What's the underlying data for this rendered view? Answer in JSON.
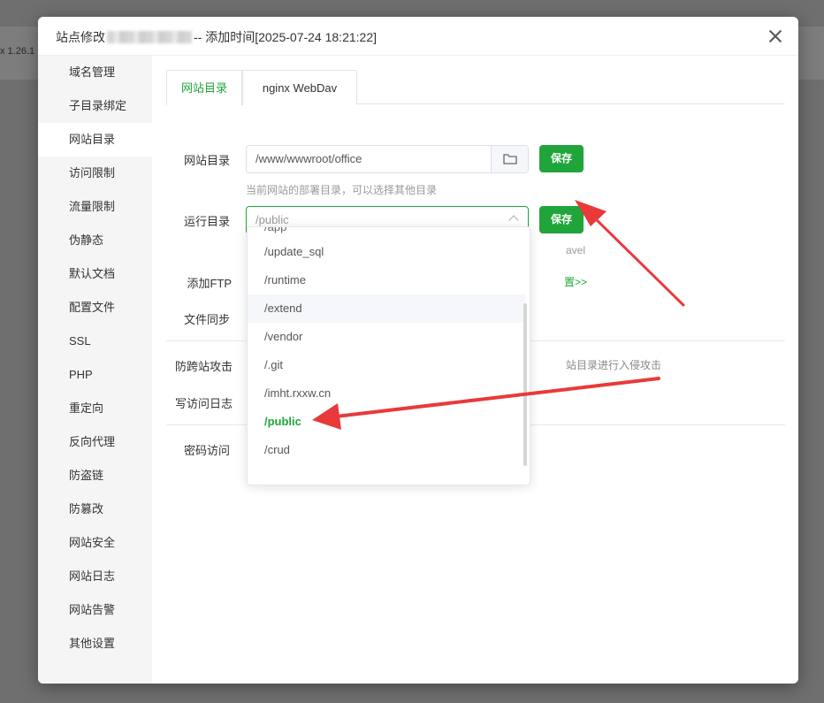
{
  "background": {
    "version_text": "x 1.26.1"
  },
  "modal": {
    "title_prefix": "站点修改",
    "title_suffix": "-- 添加时间[2025-07-24 18:21:22]"
  },
  "sidebar": {
    "items": [
      {
        "label": "域名管理"
      },
      {
        "label": "子目录绑定"
      },
      {
        "label": "网站目录"
      },
      {
        "label": "访问限制"
      },
      {
        "label": "流量限制"
      },
      {
        "label": "伪静态"
      },
      {
        "label": "默认文档"
      },
      {
        "label": "配置文件"
      },
      {
        "label": "SSL"
      },
      {
        "label": "PHP"
      },
      {
        "label": "重定向"
      },
      {
        "label": "反向代理"
      },
      {
        "label": "防盗链"
      },
      {
        "label": "防篡改"
      },
      {
        "label": "网站安全"
      },
      {
        "label": "网站日志"
      },
      {
        "label": "网站告警"
      },
      {
        "label": "其他设置"
      }
    ],
    "active_index": 2
  },
  "tabs": [
    {
      "label": "网站目录"
    },
    {
      "label": "nginx WebDav"
    }
  ],
  "form": {
    "site_dir_label": "网站目录",
    "site_dir_value": "/www/wwwroot/office",
    "save_label": "保存",
    "site_dir_hint": "当前网站的部署目录，可以选择其他目录",
    "run_dir_label": "运行目录",
    "run_dir_placeholder": "/public",
    "run_dir_hint_tail": "avel",
    "ftp_label": "添加FTP",
    "ftp_link_tail": "置>>",
    "sync_label": "文件同步",
    "anti_cross_label": "防跨站攻击",
    "anti_cross_hint_tail": "站目录进行入侵攻击",
    "access_log_label": "写访问日志",
    "password_label": "密码访问"
  },
  "dropdown": {
    "partial_top": "/app",
    "options": [
      {
        "label": "/update_sql"
      },
      {
        "label": "/runtime"
      },
      {
        "label": "/extend"
      },
      {
        "label": "/vendor"
      },
      {
        "label": "/.git"
      },
      {
        "label": "/imht.rxxw.cn"
      },
      {
        "label": "/public"
      },
      {
        "label": "/crud"
      }
    ],
    "hover_index": 2,
    "selected_index": 6
  },
  "colors": {
    "accent": "#20a53a",
    "annotation_arrow": "#e83a3a"
  }
}
